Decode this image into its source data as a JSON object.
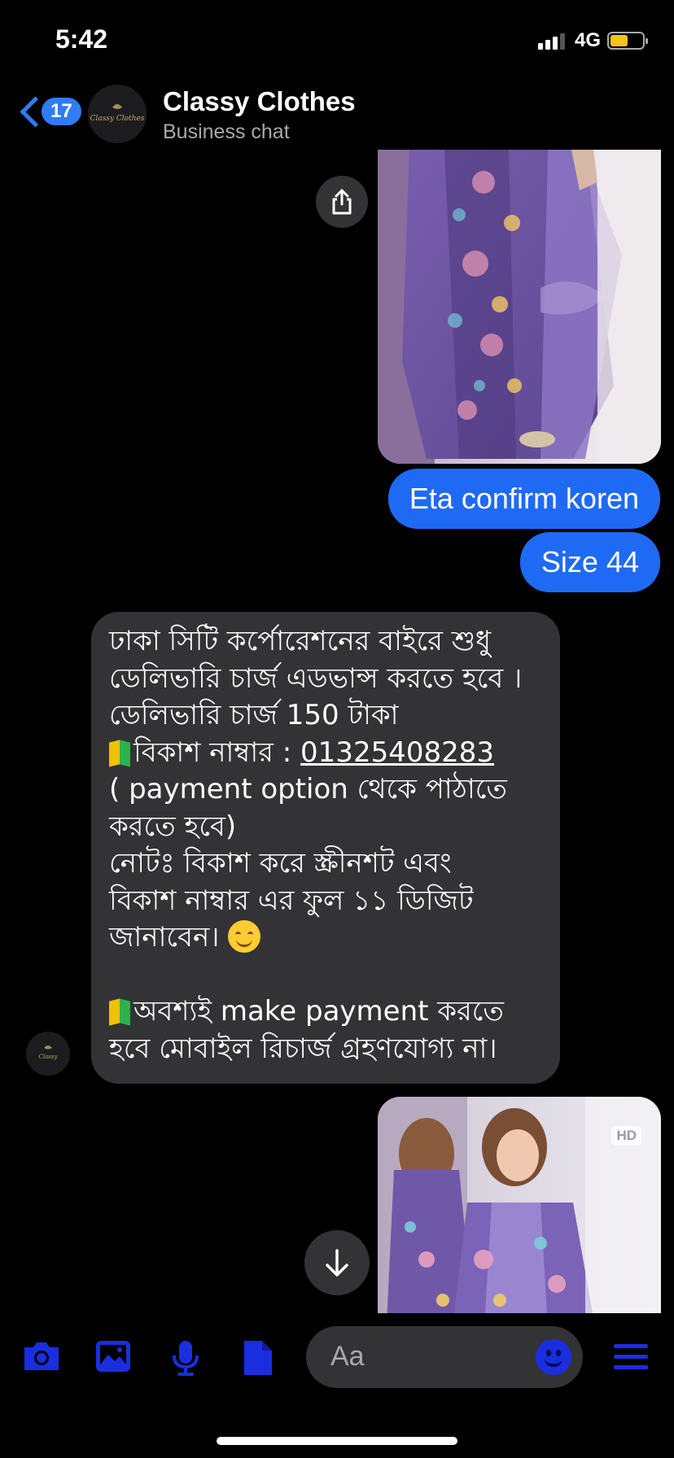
{
  "status_bar": {
    "time": "5:42",
    "network": "4G",
    "battery_level": 0.55,
    "battery_color": "#f5c518"
  },
  "header": {
    "back_count": "17",
    "contact_name": "Classy Clothes",
    "subtitle": "Business chat",
    "avatar_logo_text": "Classy Clothes",
    "back_icon": "chevron-left-icon"
  },
  "messages": {
    "outgoing": [
      {
        "text": "Eta confirm koren"
      },
      {
        "text": "Size 44"
      }
    ],
    "incoming": {
      "lines": [
        "ঢাকা সিটি কর্পোরেশনের বাইরে শুধু",
        "ডেলিভারি চার্জ এডভান্স করতে হবে ।",
        "ডেলিভারি চার্জ 150 টাকা"
      ],
      "bkash_label": "বিকাশ নাম্বার : ",
      "bkash_number": "01325408283",
      "payment_line_1": "( payment option থেকে পাঠাতে",
      "payment_line_2": "করতে হবে)",
      "note_line_1": "নোটঃ বিকাশ করে স্ক্রীনশট এবং",
      "note_line_2": "বিকাশ নাম্বার এর ফুল ১১ ডিজিট",
      "note_line_3": "জানাবেন। ",
      "warning_line_1": "অবশ্যই make payment  করতে",
      "warning_line_2": "হবে মোবাইল রিচার্জ গ্রহণযোগ্য না।"
    },
    "photo_badge": "HD"
  },
  "composer": {
    "placeholder": "Aa",
    "accent_color": "#1a2ee0"
  },
  "colors": {
    "outgoing_bubble": "#1f6af5",
    "incoming_bubble": "#333336",
    "background": "#000000"
  }
}
